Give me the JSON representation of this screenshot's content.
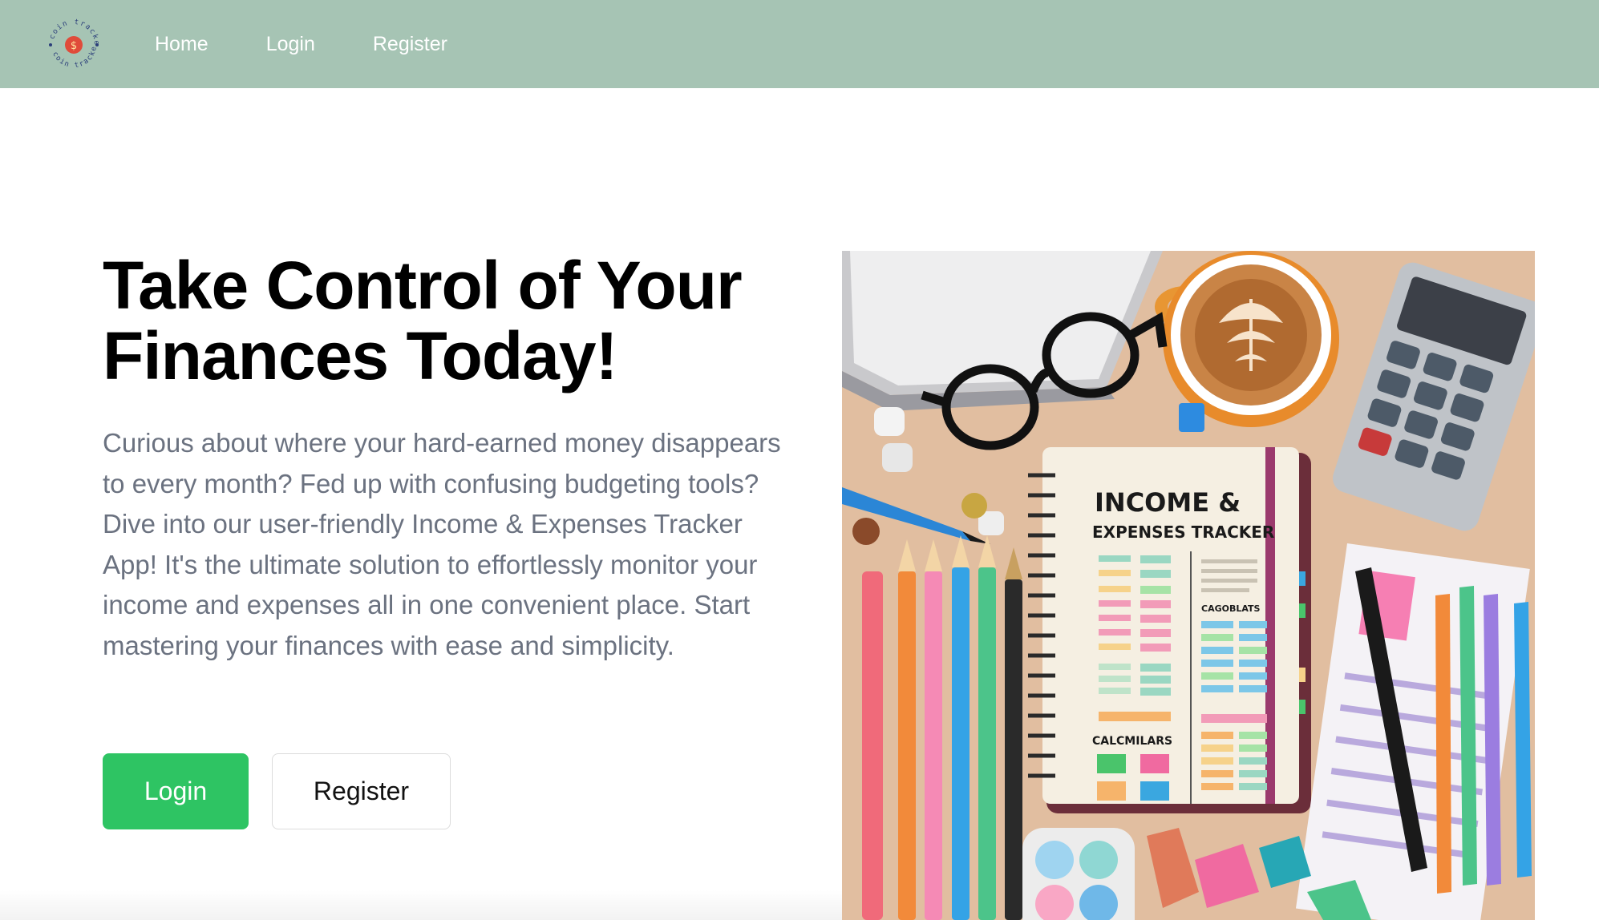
{
  "nav": {
    "logo_text": "coin tracker",
    "logo_symbol": "$",
    "links": [
      {
        "label": "Home"
      },
      {
        "label": "Login"
      },
      {
        "label": "Register"
      }
    ]
  },
  "hero": {
    "title_line1": "Take Control of Your",
    "title_line2": "Finances Today!",
    "description": "Curious about where your hard-earned money disappears to every month? Fed up with confusing budgeting tools? Dive into our user-friendly Income & Expenses Tracker App! It's the ultimate solution to effortlessly monitor your income and expenses all in one convenient place. Start mastering your finances with ease and simplicity.",
    "login_label": "Login",
    "register_label": "Register"
  },
  "image": {
    "notebook_title_1": "INCOME &",
    "notebook_title_2": "EXPENSES TRACKER",
    "notebook_section_1": "CALCMILARS",
    "notebook_section_2": "CAGOBLATS"
  },
  "colors": {
    "navbar": "#a6c4b4",
    "accent_green": "#2ec463",
    "body_text": "#6b7280"
  }
}
